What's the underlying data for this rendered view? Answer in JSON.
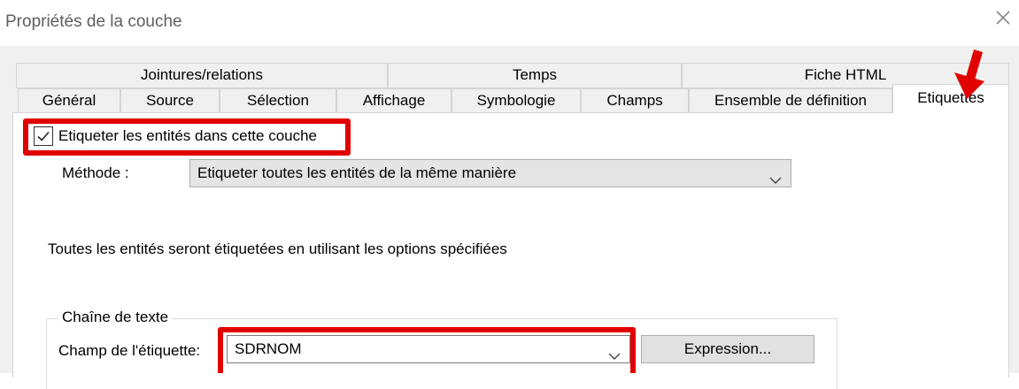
{
  "window": {
    "title": "Propriétés de la couche",
    "close_icon": "close-icon"
  },
  "tabs": {
    "row_top": [
      {
        "label": "Jointures/relations"
      },
      {
        "label": "Temps"
      },
      {
        "label": "Fiche HTML"
      }
    ],
    "row_bottom": [
      {
        "label": "Général"
      },
      {
        "label": "Source"
      },
      {
        "label": "Sélection"
      },
      {
        "label": "Affichage"
      },
      {
        "label": "Symbologie"
      },
      {
        "label": "Champs"
      },
      {
        "label": "Ensemble de définition"
      },
      {
        "label": "Etiquettes",
        "active": true
      }
    ]
  },
  "labels_tab": {
    "label_checkbox": {
      "label": "Etiqueter les entités dans cette couche",
      "checked": true
    },
    "method": {
      "label": "Méthode :",
      "value": "Etiqueter toutes les entités de la même manière"
    },
    "info_text": "Toutes les entités seront étiquetées en utilisant les options spécifiées",
    "text_string_group": {
      "title": "Chaîne de texte",
      "field_label": "Champ de l'étiquette:",
      "field_value": "SDRNOM",
      "expression_button": "Expression..."
    }
  },
  "annotations": {
    "highlight_color": "#e10000",
    "arrow_icon": "red-arrow-icon"
  },
  "colors": {
    "dialog_bg": "#f0f0f0",
    "panel_bg": "#ffffff",
    "tab_border": "#d4d4d4"
  }
}
